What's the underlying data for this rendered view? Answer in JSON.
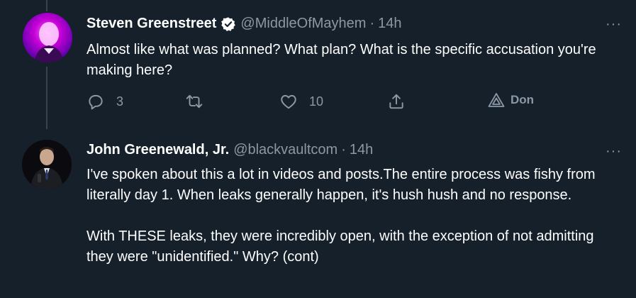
{
  "tweets": [
    {
      "display_name": "Steven Greenstreet",
      "verified": true,
      "handle": "@MiddleOfMayhem",
      "time": "14h",
      "text": "Almost like what was planned? What plan? What is the specific accusation you're making here?",
      "actions": {
        "reply_count": "3",
        "retweet_count": "",
        "like_count": "10",
        "promo_label": "Don"
      }
    },
    {
      "display_name": "John Greenewald, Jr.",
      "verified": false,
      "handle": "@blackvaultcom",
      "time": "14h",
      "text": "I've spoken about this a lot in videos and posts.The entire process was fishy from literally day 1. When leaks generally happen, it's hush hush and no response.\n\nWith THESE leaks, they were incredibly open, with the exception of not admitting they were \"unidentified.\" Why? (cont)"
    }
  ],
  "ui": {
    "separator": "·",
    "more_glyph": "···"
  },
  "colors": {
    "background": "#15202b",
    "secondary_text": "#8b98a5",
    "verified_badge": "#ffffff",
    "thread_line": "#38444d"
  },
  "icons": {
    "reply": "reply-icon",
    "retweet": "retweet-icon",
    "like": "heart-icon",
    "share": "share-icon",
    "promo": "triangle-logo-icon",
    "verified": "verified-badge-icon",
    "more": "more-options-icon"
  }
}
